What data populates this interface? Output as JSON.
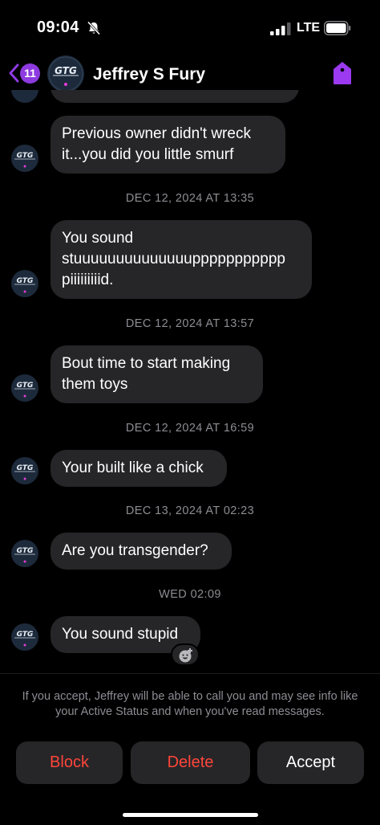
{
  "status_bar": {
    "time": "09:04",
    "network": "LTE"
  },
  "header": {
    "back_count": "11",
    "contact_name": "Jeffrey S Fury",
    "avatar_text": "GTG"
  },
  "messages": [
    {
      "text": "Previous owner didn't wreck\nit...you did you little smurf"
    },
    {
      "text": "You sound\nstuuuuuuuuuuuuuuppppppppppp\npiiiiiiiiid."
    },
    {
      "text": "Bout time to start making\nthem toys"
    },
    {
      "text": "Your built like a chick"
    },
    {
      "text": "Are you transgender?"
    },
    {
      "text": "You sound stupid"
    }
  ],
  "timestamps": [
    "DEC 12, 2024 AT 13:35",
    "DEC 12, 2024 AT 13:57",
    "DEC 12, 2024 AT 16:59",
    "DEC 13, 2024 AT 02:23",
    "WED 02:09"
  ],
  "request": {
    "notice": "If you accept, Jeffrey will be able to call you and may see info like your Active Status and when you've read messages.",
    "block_label": "Block",
    "delete_label": "Delete",
    "accept_label": "Accept"
  },
  "colors": {
    "accent": "#8d3ae0",
    "destructive": "#ff453a",
    "bubble": "#262628",
    "secondary_text": "#8d8d93"
  },
  "icons": [
    "bell-off-icon",
    "signal-icon",
    "battery-icon",
    "chevron-left-icon",
    "tag-icon",
    "emoji-reaction-icon"
  ]
}
